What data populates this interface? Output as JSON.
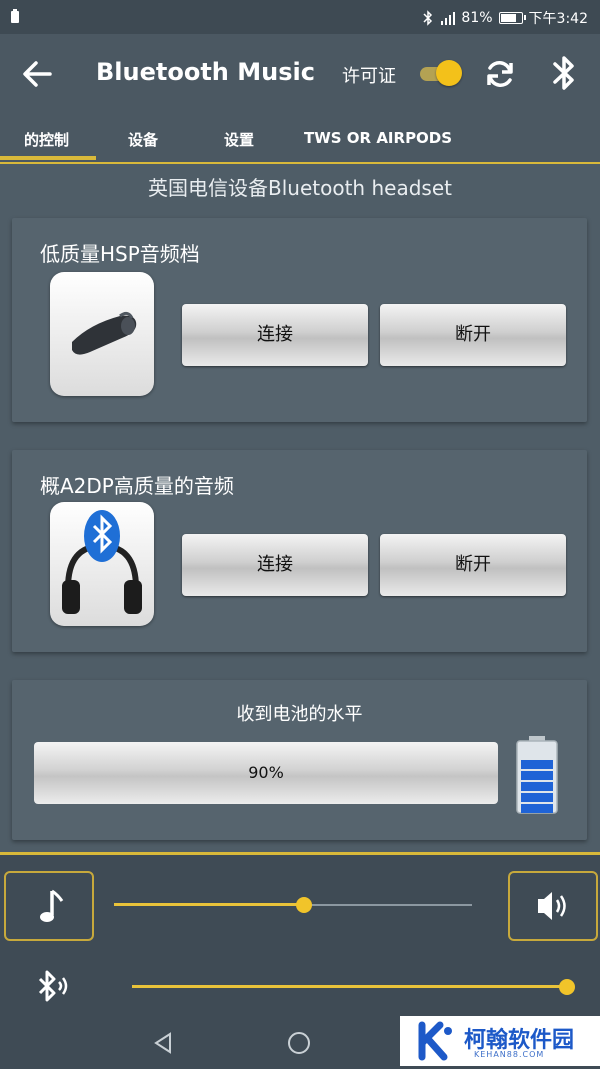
{
  "status_bar": {
    "battery_percent": "81%",
    "battery_level": 0.81,
    "time": "下午3:42"
  },
  "header": {
    "title": "Bluetooth Music",
    "license_label": "许可证",
    "license_toggle_on": true
  },
  "tabs": [
    {
      "label": "的控制",
      "active": true
    },
    {
      "label": "设备",
      "active": false
    },
    {
      "label": "设置",
      "active": false
    },
    {
      "label": "TWS OR AIRPODS",
      "active": false
    }
  ],
  "device_name": "英国电信设备Bluetooth headset",
  "profiles": [
    {
      "title": "低质量HSP音频档",
      "connect_label": "连接",
      "disconnect_label": "断开",
      "icon": "headset-icon"
    },
    {
      "title": "概A2DP高质量的音频",
      "connect_label": "连接",
      "disconnect_label": "断开",
      "icon": "bluetooth-headphones-icon"
    }
  ],
  "battery": {
    "title": "收到电池的水平",
    "value_text": "90%",
    "level": 0.9
  },
  "sliders": {
    "music_volume": 0.53,
    "bluetooth_volume": 1.0
  },
  "watermark": {
    "text": "柯翰软件园",
    "sub": "KEHAN88.COM"
  },
  "colors": {
    "accent": "#d9b93a",
    "background": "#4f5d67",
    "card": "#56646e"
  }
}
